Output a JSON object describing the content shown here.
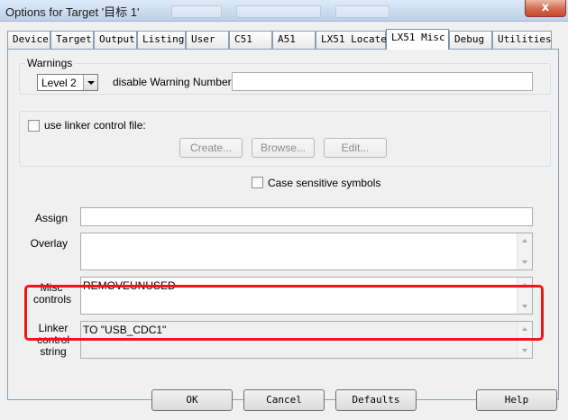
{
  "window": {
    "title": "Options for Target '目标 1'",
    "close_glyph": "x"
  },
  "tabs": [
    "Device",
    "Target",
    "Output",
    "Listing",
    "User",
    "C51",
    "A51",
    "LX51 Locate",
    "LX51 Misc",
    "Debug",
    "Utilities"
  ],
  "active_tab": "LX51 Misc",
  "warnings": {
    "legend": "Warnings",
    "level_value": "Level 2",
    "disable_label": "disable Warning Numbers:",
    "disable_value": ""
  },
  "linker_file": {
    "checkbox_label": "use linker control file:",
    "checked": false,
    "create_label": "Create...",
    "browse_label": "Browse...",
    "edit_label": "Edit..."
  },
  "case_sensitive": {
    "label": "Case sensitive symbols",
    "checked": false
  },
  "fields": {
    "assign_label": "Assign",
    "assign_value": "",
    "overlay_label": "Overlay",
    "overlay_value": "",
    "misc_label_line1": "Misc",
    "misc_label_line2": "controls",
    "misc_value": "REMOVEUNUSED",
    "linker_label_line1": "Linker",
    "linker_label_line2": "control",
    "linker_label_line3": "string",
    "linker_value": "TO \"USB_CDC1\""
  },
  "footer": {
    "ok_label": "OK",
    "cancel_label": "Cancel",
    "defaults_label": "Defaults",
    "help_label": "Help"
  },
  "colors": {
    "highlight": "#f01616",
    "dialog_bg": "#f0f0f0",
    "close_button": "#d36b4c"
  }
}
